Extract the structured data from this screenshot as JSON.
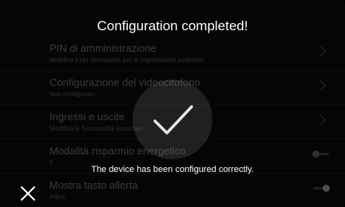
{
  "dialog": {
    "title": "Configuration completed!",
    "message": "The device has been configured correctly.",
    "close_icon": "close-icon",
    "check_icon": "checkmark-icon"
  },
  "settings": [
    {
      "title": "PIN di amministrazione",
      "subtitle": "Modifica il pin necessario per le impostazioni avanzate",
      "control": "chevron"
    },
    {
      "title": "Configurazione del videocitofono",
      "subtitle": "Non configurato",
      "control": "chevron"
    },
    {
      "title": "Ingressi e uscite",
      "subtitle": "Modifica le funzionalità associate",
      "control": "chevron"
    },
    {
      "title": "Modalità risparmio energetico",
      "subtitle": "Il",
      "control": "toggle",
      "state": "off"
    },
    {
      "title": "Mostra tasto allerta",
      "subtitle": "Attivo",
      "control": "toggle",
      "state": "on"
    }
  ]
}
